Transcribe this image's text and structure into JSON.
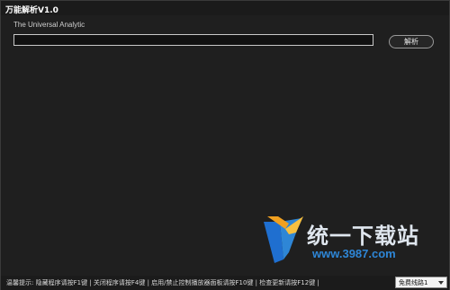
{
  "window": {
    "title": "万能解析V1.0",
    "subtitle": "The Universal Analytic"
  },
  "url_input": {
    "value": "",
    "placeholder": ""
  },
  "parse_button": {
    "label": "解析"
  },
  "watermark": {
    "text_cn": "统一下载站",
    "url": "www.3987.com"
  },
  "status_bar": {
    "text": "温馨提示: 隐藏程序请按F1键 | 关闭程序请按F4键 | 启用/禁止控制播放器面板请按F10键 | 检查更新请按F12键 |"
  },
  "line_select": {
    "selected": "免费线路1",
    "options": [
      "免费线路1"
    ]
  },
  "colors": {
    "background": "#1f1f1f",
    "watermark_blue": "#2e86d6",
    "watermark_orange": "#f0a020"
  }
}
